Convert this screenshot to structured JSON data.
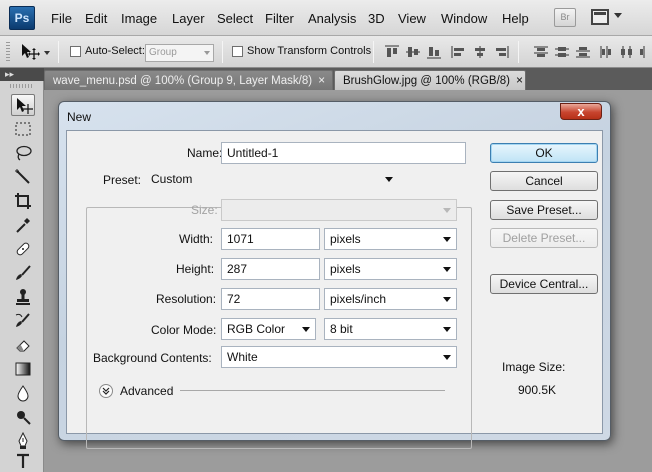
{
  "app": {
    "logo_text": "Ps"
  },
  "menu": [
    "File",
    "Edit",
    "Image",
    "Layer",
    "Select",
    "Filter",
    "Analysis",
    "3D",
    "View",
    "Window",
    "Help"
  ],
  "menubar_right": {
    "bridge_label": "Br"
  },
  "options_bar": {
    "auto_select_label": "Auto-Select:",
    "auto_select_checked": false,
    "auto_select_value": "Group",
    "show_transform_label": "Show Transform Controls",
    "show_transform_checked": false
  },
  "tabs": [
    {
      "label": "wave_menu.psd @ 100% (Group 9, Layer Mask/8)",
      "close": "×",
      "active": false
    },
    {
      "label": "BrushGlow.jpg @ 100% (RGB/8)",
      "close": "×",
      "active": true
    }
  ],
  "dialog": {
    "title": "New",
    "close_label": "x",
    "name_label": "Name:",
    "name_value": "Untitled-1",
    "preset_label": "Preset:",
    "preset_value": "Custom",
    "size_label": "Size:",
    "size_value": "",
    "width_label": "Width:",
    "width_value": "1071",
    "width_unit": "pixels",
    "height_label": "Height:",
    "height_value": "287",
    "height_unit": "pixels",
    "resolution_label": "Resolution:",
    "resolution_value": "72",
    "resolution_unit": "pixels/inch",
    "color_mode_label": "Color Mode:",
    "color_mode_value": "RGB Color",
    "bit_depth_value": "8 bit",
    "background_label": "Background Contents:",
    "background_value": "White",
    "advanced_label": "Advanced",
    "buttons": {
      "ok": "OK",
      "cancel": "Cancel",
      "save_preset": "Save Preset...",
      "delete_preset": "Delete Preset...",
      "device_central": "Device Central..."
    },
    "image_size_label": "Image Size:",
    "image_size_value": "900.5K"
  },
  "colors": {
    "dialog_bg": "#d0dbe7",
    "panel_bg": "#f0f0f0",
    "ok_button": "#bfe3f6",
    "close_button": "#c8452f"
  }
}
